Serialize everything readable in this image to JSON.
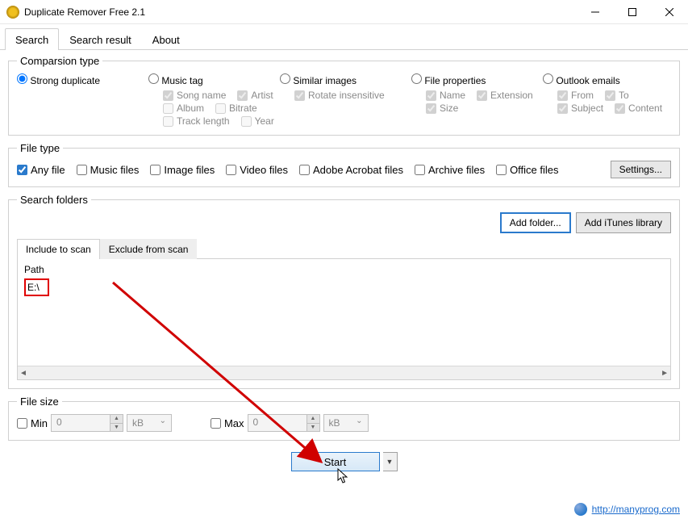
{
  "window": {
    "title": "Duplicate Remover Free 2.1"
  },
  "tabs": {
    "search": "Search",
    "search_result": "Search result",
    "about": "About"
  },
  "comparison": {
    "legend": "Comparsion type",
    "strong": "Strong duplicate",
    "music": "Music tag",
    "music_opts": {
      "song": "Song name",
      "artist": "Artist",
      "album": "Album",
      "bitrate": "Bitrate",
      "tracklen": "Track length",
      "year": "Year"
    },
    "similar": "Similar images",
    "similar_opts": {
      "rotate": "Rotate insensitive"
    },
    "fileprops": "File properties",
    "fileprops_opts": {
      "name": "Name",
      "ext": "Extension",
      "size": "Size"
    },
    "outlook": "Outlook emails",
    "outlook_opts": {
      "from": "From",
      "to": "To",
      "subject": "Subject",
      "content": "Content"
    }
  },
  "filetype": {
    "legend": "File type",
    "any": "Any file",
    "music": "Music files",
    "image": "Image files",
    "video": "Video files",
    "acrobat": "Adobe Acrobat files",
    "archive": "Archive files",
    "office": "Office files",
    "settings": "Settings..."
  },
  "folders": {
    "legend": "Search folders",
    "add_folder": "Add folder...",
    "add_itunes": "Add iTunes library",
    "include_tab": "Include to scan",
    "exclude_tab": "Exclude from scan",
    "path_header": "Path",
    "path_entry": "E:\\"
  },
  "filesize": {
    "legend": "File size",
    "min_label": "Min",
    "max_label": "Max",
    "min_val": "0",
    "max_val": "0",
    "unit": "kB"
  },
  "start": {
    "label": "Start"
  },
  "footer": {
    "url": "http://manyprog.com"
  }
}
